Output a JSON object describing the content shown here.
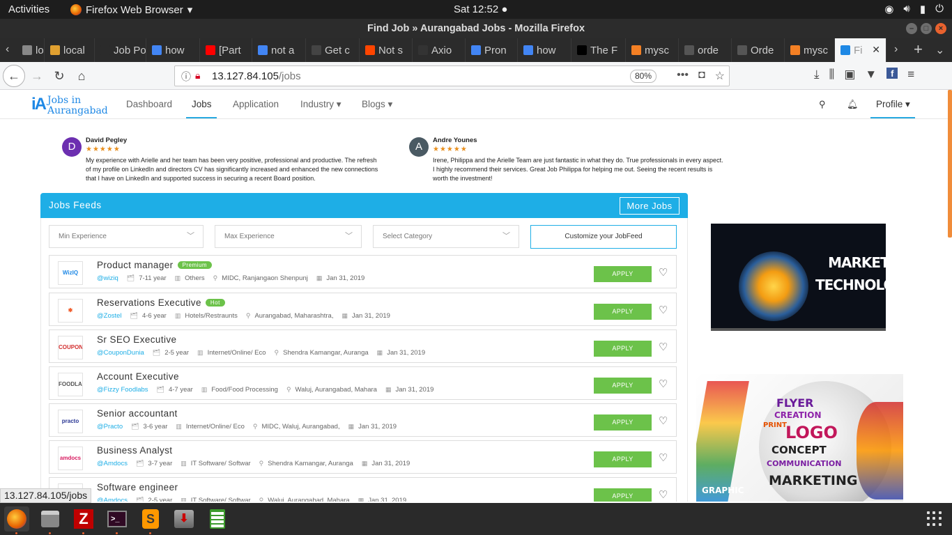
{
  "system": {
    "activities": "Activities",
    "app_name": "Firefox Web Browser",
    "clock": "Sat 12:52 ●"
  },
  "window": {
    "title": "Find Job » Aurangabad Jobs - Mozilla Firefox"
  },
  "tabs": [
    {
      "label": "loc",
      "color": "#888888"
    },
    {
      "label": "local",
      "color": "#e0a030"
    },
    {
      "label": "Job Por",
      "color": "#2b2b2b"
    },
    {
      "label": "how",
      "color": "#4285f4"
    },
    {
      "label": "[Part",
      "color": "#ff0000"
    },
    {
      "label": "not a",
      "color": "#4285f4"
    },
    {
      "label": "Get c",
      "color": "#444444"
    },
    {
      "label": "Not s",
      "color": "#ff4500"
    },
    {
      "label": "Axio",
      "color": "#333333"
    },
    {
      "label": "Pron",
      "color": "#4285f4"
    },
    {
      "label": "how",
      "color": "#4285f4"
    },
    {
      "label": "The F",
      "color": "#000000"
    },
    {
      "label": "mysc",
      "color": "#f48024"
    },
    {
      "label": "orde",
      "color": "#555555"
    },
    {
      "label": "Orde",
      "color": "#555555"
    },
    {
      "label": "mysc",
      "color": "#f48024"
    },
    {
      "label": "Fi",
      "color": "#1e88e5"
    }
  ],
  "url": {
    "host": "13.127.84.105",
    "path": "/jobs",
    "zoom": "80%"
  },
  "site": {
    "logo_line1": "Jobs in",
    "logo_line2": "Aurangabad",
    "nav": [
      "Dashboard",
      "Jobs",
      "Application",
      "Industry ▾",
      "Blogs ▾"
    ],
    "profile": "Profile ▾"
  },
  "testimonials": [
    {
      "initial": "D",
      "name": "David Pegley",
      "stars": "★★★★★",
      "text": "My experience with Arielle and her team has been very positive, professional and productive. The refresh of my profile on LinkedIn and directors CV has significantly increased and enhanced the new connections that I have on LinkedIn and supported success in securing a recent Board position.",
      "color": "#6c2fb0"
    },
    {
      "initial": "A",
      "name": "Andre Younes",
      "stars": "★★★★★",
      "text": "Irene, Philippa and the Arielle Team are just fantastic in what they do.  True professionals in every aspect. I highly recommend their services.  Great Job Philippa for helping me out.  Seeing the recent results is worth the investment!",
      "color": "#4a5a63"
    }
  ],
  "feed": {
    "title": "Jobs Feeds",
    "more": "More Jobs",
    "filters": [
      "Min Experience",
      "Max Experience",
      "Select Category"
    ],
    "customize": "Customize your JobFeed",
    "apply_label": "APPLY",
    "jobs": [
      {
        "title": "Product manager",
        "badge": "Premium",
        "company": "@wiziq",
        "exp": "7-11 year",
        "category": "Others",
        "location": "MIDC, Ranjangaon Shenpunj",
        "date": "Jan 31, 2019",
        "logo": "WizIQ",
        "logo_color": "#1e88e5"
      },
      {
        "title": "Reservations Executive",
        "badge": "Hot",
        "company": "@Zostel",
        "exp": "4-6 year",
        "category": "Hotels/Restraunts",
        "location": "Aurangabad, Maharashtra,",
        "date": "Jan 31, 2019",
        "logo": "✱",
        "logo_color": "#f05a28"
      },
      {
        "title": "Sr SEO Executive",
        "badge": "",
        "company": "@CouponDunia",
        "exp": "2-5 year",
        "category": "Internet/Online/ Eco",
        "location": "Shendra Kamangar, Auranga",
        "date": "Jan 31, 2019",
        "logo": "COUPON",
        "logo_color": "#d32f2f"
      },
      {
        "title": "Account Executive",
        "badge": "",
        "company": "@Fizzy Foodlabs",
        "exp": "4-7 year",
        "category": "Food/Food Processing",
        "location": "Waluj, Aurangabad, Mahara",
        "date": "Jan 31, 2019",
        "logo": "FOODLABS",
        "logo_color": "#555555"
      },
      {
        "title": "Senior accountant",
        "badge": "",
        "company": "@Practo",
        "exp": "3-6 year",
        "category": "Internet/Online/ Eco",
        "location": "MIDC, Waluj, Aurangabad,",
        "date": "Jan 31, 2019",
        "logo": "practo",
        "logo_color": "#283593"
      },
      {
        "title": "Business Analyst",
        "badge": "",
        "company": "@Amdocs",
        "exp": "3-7 year",
        "category": "IT Software/ Softwar",
        "location": "Shendra Kamangar, Auranga",
        "date": "Jan 31, 2019",
        "logo": "amdocs",
        "logo_color": "#d81b60"
      },
      {
        "title": "Software engineer",
        "badge": "",
        "company": "@Amdocs",
        "exp": "2-5 year",
        "category": "IT Software/ Softwar",
        "location": "Waluj, Aurangabad, Mahara",
        "date": "Jan 31, 2019",
        "logo": "",
        "logo_color": "#d81b60"
      }
    ]
  },
  "ads": {
    "ad1_line1": "MARKETING",
    "ad1_line2": "TECHNOLOGIST",
    "ad2_words": [
      "FLYER",
      "CREATION",
      "LOGO",
      "CONCEPT",
      "COMMUNICATION",
      "MARKETING",
      "GRAPHIC",
      "PRINT"
    ]
  },
  "status_url": "13.127.84.105/jobs"
}
